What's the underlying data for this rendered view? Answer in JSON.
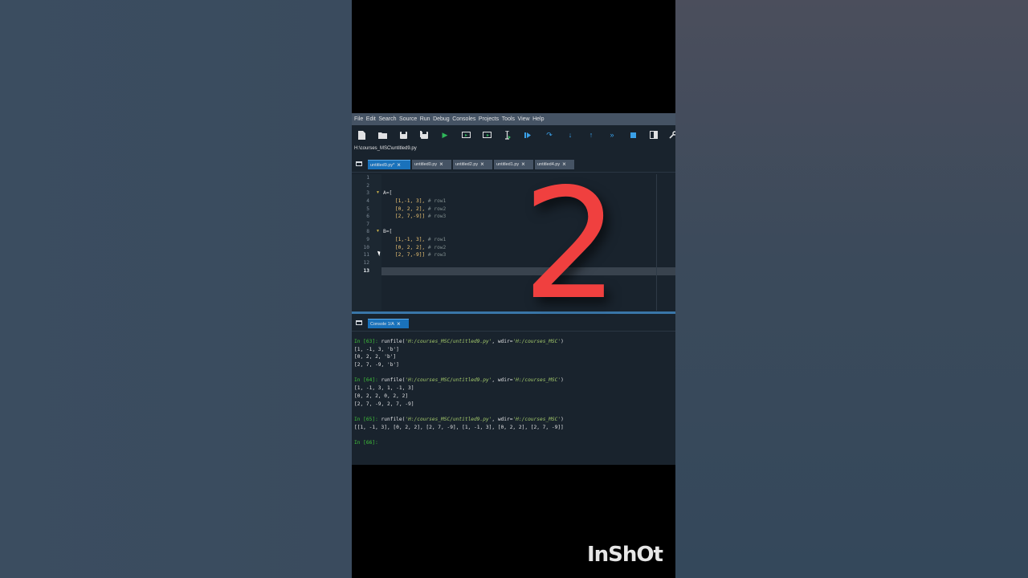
{
  "ide": {
    "menu": [
      "File",
      "Edit",
      "Search",
      "Source",
      "Run",
      "Debug",
      "Consoles",
      "Projects",
      "Tools",
      "View",
      "Help"
    ],
    "toolbar_icons": [
      "new-file-icon",
      "open-folder-icon",
      "save-icon",
      "save-all-icon",
      "run-icon",
      "run-cell-icon",
      "run-cell-advance-icon",
      "run-selection-icon",
      "debug-icon",
      "step-over-icon",
      "step-into-icon",
      "step-return-icon",
      "continue-icon",
      "stop-icon",
      "maximize-pane-icon",
      "wrench-icon"
    ],
    "path": "H:\\courses_MSC\\untitled9.py",
    "editor_tabs": [
      {
        "label": "untitled9.py*",
        "active": true
      },
      {
        "label": "untitled0.py",
        "active": false
      },
      {
        "label": "untitled2.py",
        "active": false
      },
      {
        "label": "untitled1.py",
        "active": false
      },
      {
        "label": "untitled4.py",
        "active": false
      }
    ],
    "line_numbers": [
      "1",
      "2",
      "3",
      "4",
      "5",
      "6",
      "7",
      "8",
      "9",
      "10",
      "11",
      "12",
      "13"
    ],
    "current_line": "13",
    "code": {
      "l3": "A=[",
      "l4_nums": "[1,-1, 3],",
      "l4_cm": " # row1",
      "l5_nums": "[0, 2, 2],",
      "l5_cm": " # row2",
      "l6_nums": "[2, 7,-9]]",
      "l6_cm": " # row3",
      "l8": "B=[",
      "l9_nums": "[1,-1, 3],",
      "l9_cm": " # row1",
      "l10_nums": "[0, 2, 2],",
      "l10_cm": " # row2",
      "l11_nums": "[2, 7,-9]]",
      "l11_cm": " # row3"
    },
    "console_tab": "Console 1/A",
    "console": {
      "p63_label": "In [63]:",
      "p63_pre": " runfile(",
      "p63_file": "'H:/courses_MSC/untitled9.py'",
      "p63_mid": ", wdir=",
      "p63_dir": "'H:/courses_MSC'",
      "p63_end": ")",
      "o63_1": "[1, -1, 3, 'b']",
      "o63_2": "[0, 2, 2, 'b']",
      "o63_3": "[2, 7, -9, 'b']",
      "p64_label": "In [64]:",
      "p64_pre": " runfile(",
      "p64_file": "'H:/courses_MSC/untitled9.py'",
      "p64_mid": ", wdir=",
      "p64_dir": "'H:/courses_MSC'",
      "p64_end": ")",
      "o64_1": "[1, -1, 3, 1, -1, 3]",
      "o64_2": "[0, 2, 2, 0, 2, 2]",
      "o64_3": "[2, 7, -9, 2, 7, -9]",
      "p65_label": "In [65]:",
      "p65_pre": " runfile(",
      "p65_file": "'H:/courses_MSC/untitled9.py'",
      "p65_mid": ", wdir=",
      "p65_dir": "'H:/courses_MSC'",
      "p65_end": ")",
      "o65_1": "[[1, -1, 3], [0, 2, 2], [2, 7, -9], [1, -1, 3], [0, 2, 2], [2, 7, -9]]",
      "p66_label": "In [66]:"
    }
  },
  "overlay": {
    "big_number": "2",
    "watermark": "InShOt"
  },
  "colors": {
    "menubar": "#455364",
    "ide_bg": "#19232d",
    "active_tab": "#1a72bb",
    "prompt_green": "#3fc23a",
    "big_number": "#f0403f"
  }
}
